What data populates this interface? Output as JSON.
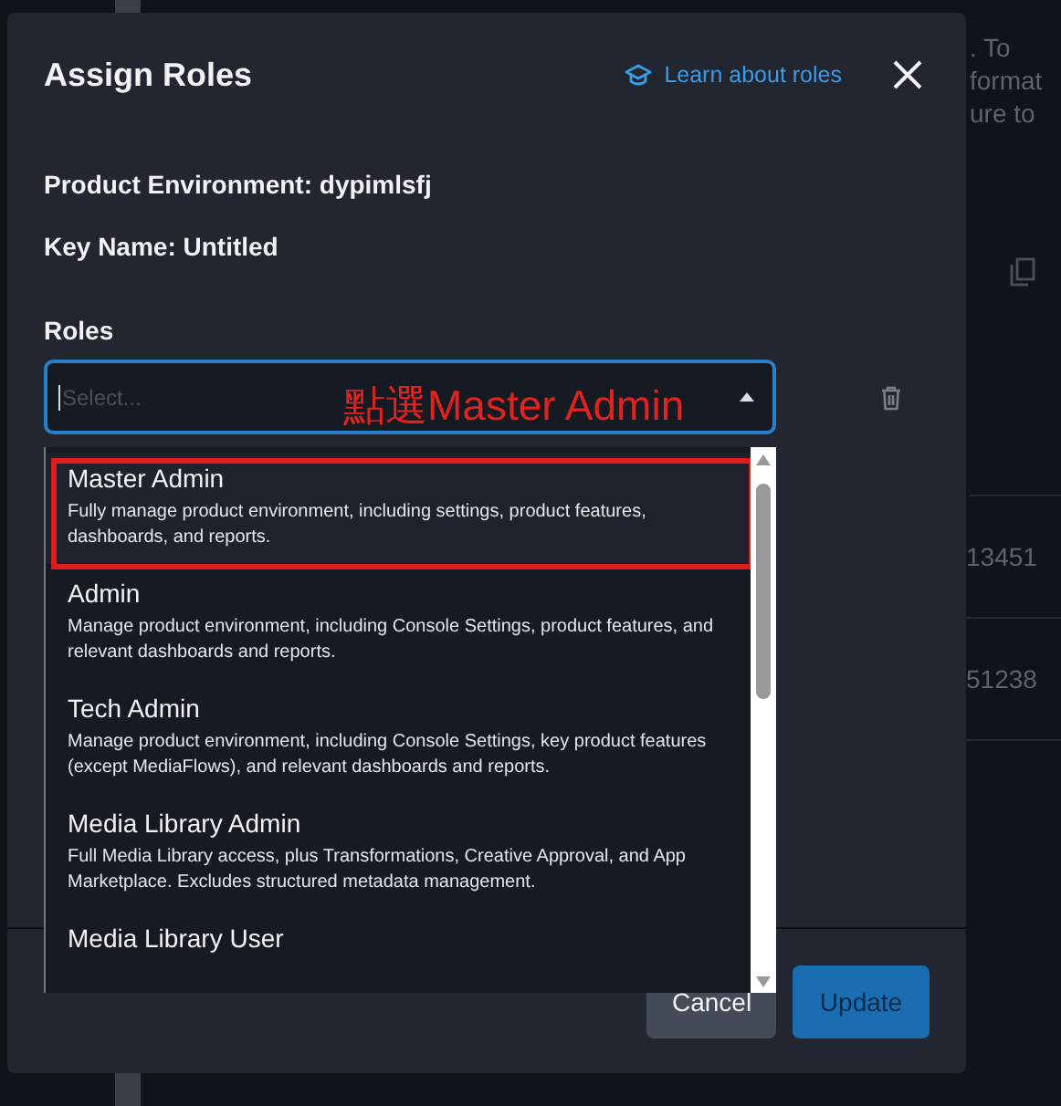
{
  "background_page": {
    "text_fragments": [
      {
        "text": ". To"
      },
      {
        "text": "format"
      },
      {
        "text": "ure to"
      }
    ],
    "key_ids": [
      "13451",
      "51238"
    ]
  },
  "dialog": {
    "title": "Assign Roles",
    "help_link": "Learn about roles",
    "fields": [
      {
        "label": "Product Environment:",
        "value": "dypimlsfj"
      },
      {
        "label": "Key Name:",
        "value": "Untitled"
      }
    ],
    "roles_label": "Roles",
    "role_select": {
      "placeholder": "Select..."
    },
    "role_options": [
      {
        "name": "Master Admin",
        "description": "Fully manage product environment, including settings, product features, dashboards, and reports.",
        "highlighted": true,
        "marked": true
      },
      {
        "name": "Admin",
        "description": "Manage product environment, including Console Settings, product features, and relevant dashboards and reports.",
        "highlighted": false,
        "marked": false
      },
      {
        "name": "Tech Admin",
        "description": "Manage product environment, including Console Settings, key product features (except MediaFlows), and relevant dashboards and reports.",
        "highlighted": false,
        "marked": false
      },
      {
        "name": "Media Library Admin",
        "description": "Full Media Library access, plus Transformations, Creative Approval, and App Marketplace. Excludes structured metadata management.",
        "highlighted": false,
        "marked": false
      },
      {
        "name": "Media Library User",
        "highlighted": false,
        "marked": false
      }
    ],
    "buttons": [
      {
        "label": "Cancel",
        "kind": "secondary",
        "disabled": false
      },
      {
        "label": "Update",
        "kind": "primary",
        "disabled": true
      }
    ]
  },
  "annotation": {
    "text": "點選Master Admin"
  }
}
